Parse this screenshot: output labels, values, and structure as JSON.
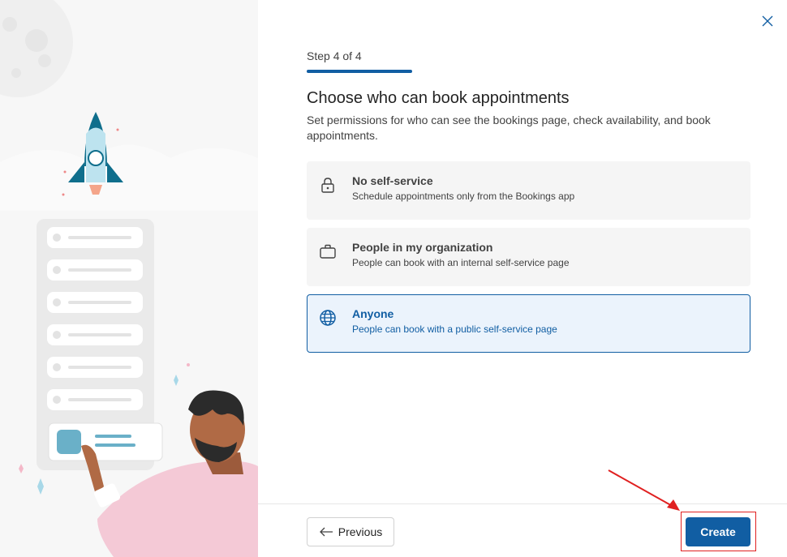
{
  "wizard": {
    "step_label": "Step 4 of 4",
    "title": "Choose who can book appointments",
    "subtitle": "Set permissions for who can see the bookings page, check availability, and book appointments."
  },
  "options": [
    {
      "icon": "lock-icon",
      "title": "No self-service",
      "description": "Schedule appointments only from the Bookings app",
      "selected": false
    },
    {
      "icon": "briefcase-icon",
      "title": "People in my organization",
      "description": "People can book with an internal self-service page",
      "selected": false
    },
    {
      "icon": "globe-icon",
      "title": "Anyone",
      "description": "People can book with a public self-service page",
      "selected": true
    }
  ],
  "footer": {
    "previous_label": "Previous",
    "create_label": "Create"
  },
  "colors": {
    "accent": "#115ea3",
    "annotation": "#e02020"
  }
}
